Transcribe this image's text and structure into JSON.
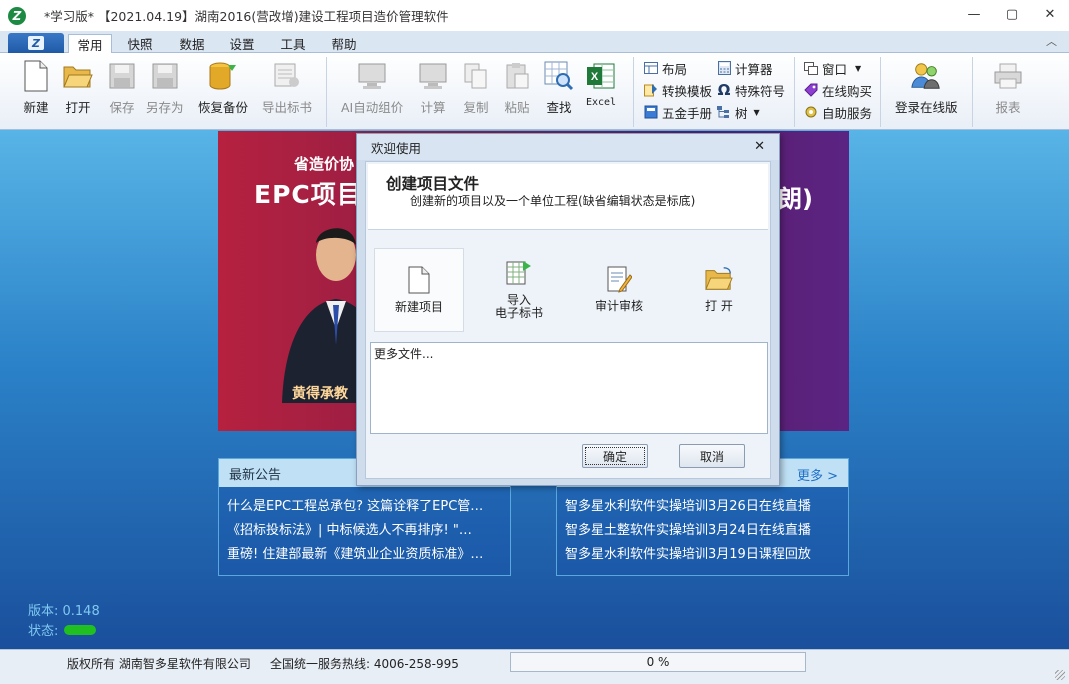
{
  "window": {
    "title": "*学习版* 【2021.04.19】湖南2016(营改增)建设工程项目造价管理软件",
    "controls": {
      "minimize": "—",
      "maximize": "▢",
      "close": "✕"
    }
  },
  "tabs": [
    {
      "label": "常用"
    },
    {
      "label": "快照"
    },
    {
      "label": "数据"
    },
    {
      "label": "设置"
    },
    {
      "label": "工具"
    },
    {
      "label": "帮助"
    }
  ],
  "ribbon": {
    "new": "新建",
    "open": "打开",
    "save": "保存",
    "save_as": "另存为",
    "restore_backup": "恢复备份",
    "export_bid": "导出标书",
    "ai_price": "AI自动组价",
    "calculate": "计算",
    "copy": "复制",
    "paste": "粘贴",
    "find": "查找",
    "excel": "Excel",
    "layout": "布局",
    "convert_template": "转换模板",
    "hardware_manual": "五金手册",
    "calculator": "计算器",
    "special_symbol": "特殊符号",
    "tree": "树",
    "window": "窗口",
    "online_purchase": "在线购买",
    "self_service": "自助服务",
    "login_online": "登录在线版",
    "report": "报表"
  },
  "banner": {
    "top_text": "省造价协",
    "headline": "EPC项目",
    "right_text": "朗)",
    "name": "黄得承教"
  },
  "announcements": {
    "title": "最新公告",
    "items": [
      "什么是EPC工程总承包? 这篇诠释了EPC管…",
      "《招标投标法》| 中标候选人不再排序!  \"…",
      "重磅! 住建部最新《建筑业企业资质标准》…"
    ]
  },
  "training": {
    "more": "更多 >",
    "items": [
      "智多星水利软件实操培训3月26日在线直播",
      "智多星土整软件实操培训3月24日在线直播",
      "智多星水利软件实操培训3月19日课程回放"
    ]
  },
  "version": {
    "label": "版本: 0.148",
    "state_label": "状态:"
  },
  "statusbar": {
    "copyright": "版权所有  湖南智多星软件有限公司",
    "hotline": "全国统一服务热线: 4006-258-995",
    "progress": "0 %",
    "progress_value": 0
  },
  "dialog": {
    "title": "欢迎使用",
    "close": "✕",
    "heading": "创建项目文件",
    "description": "创建新的项目以及一个单位工程(缺省编辑状态是标底)",
    "options": [
      {
        "label": "新建项目"
      },
      {
        "label": "导入\n电子标书"
      },
      {
        "label": "审计审核"
      },
      {
        "label": "打    开"
      }
    ],
    "more_files": "更多文件...",
    "ok": "确定",
    "cancel": "取消"
  },
  "colors": {
    "ribbon_bg": "#e9eff7",
    "main_top": "#58b4e6",
    "main_bottom": "#1a4f9c",
    "status_green": "#21c021"
  }
}
